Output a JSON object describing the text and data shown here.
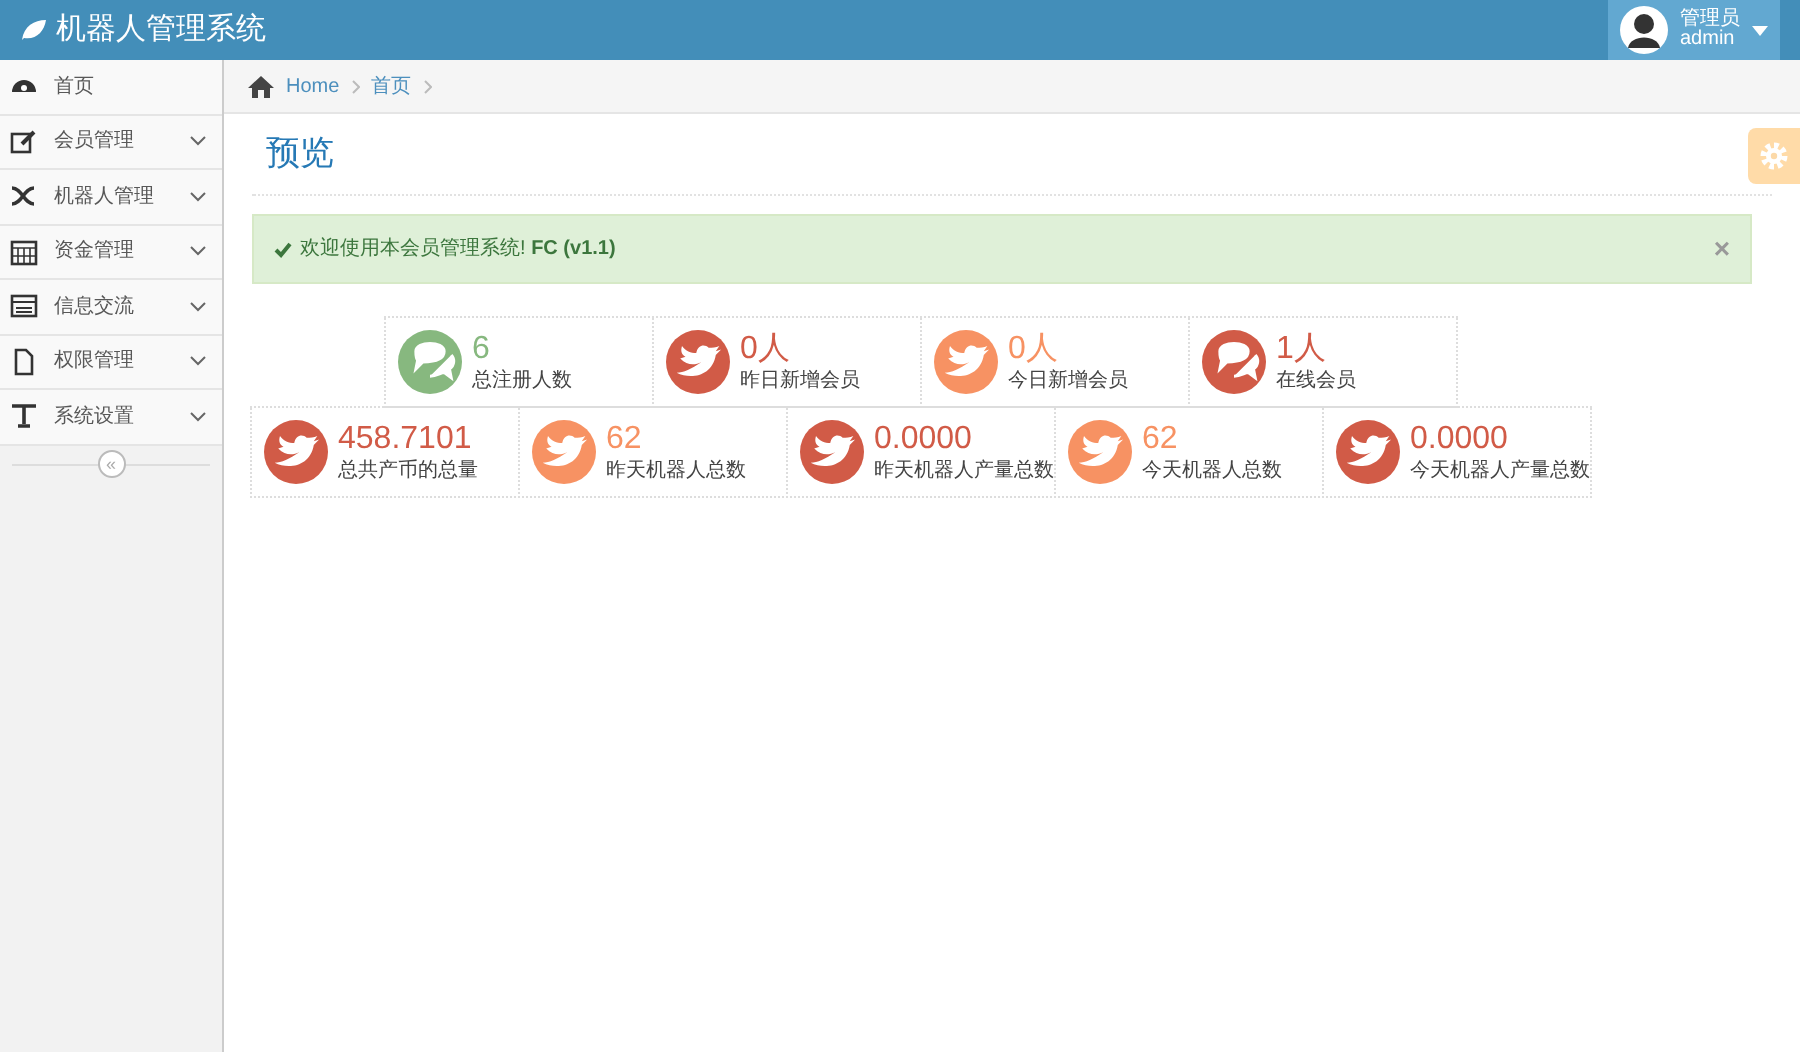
{
  "header": {
    "title": "机器人管理系统",
    "user": {
      "role": "管理员",
      "name": "admin"
    }
  },
  "sidebar": {
    "items": [
      {
        "label": "首页",
        "has_submenu": false
      },
      {
        "label": "会员管理",
        "has_submenu": true
      },
      {
        "label": "机器人管理",
        "has_submenu": true
      },
      {
        "label": "资金管理",
        "has_submenu": true
      },
      {
        "label": "信息交流",
        "has_submenu": true
      },
      {
        "label": "权限管理",
        "has_submenu": true
      },
      {
        "label": "系统设置",
        "has_submenu": true
      }
    ],
    "collapse_button": "«"
  },
  "breadcrumb": [
    "Home",
    "首页"
  ],
  "page_title": "预览",
  "alert": {
    "text": "欢迎使用本会员管理系统! **FC (v1.1)**",
    "close": "×"
  },
  "stat_rows": [
    [
      {
        "value": "6",
        "label": "总注册人数",
        "color": "#87b87f",
        "kind": "chat"
      },
      {
        "value": "0人",
        "label": "昨日新增会员",
        "color": "#d15b47",
        "kind": "bird"
      },
      {
        "value": "0人",
        "label": "今日新增会员",
        "color": "#f79263",
        "kind": "bird"
      },
      {
        "value": "1人",
        "label": "在线会员",
        "color": "#d15b47",
        "kind": "chat"
      }
    ],
    [
      {
        "value": "458.7101",
        "label": "总共产币的总量",
        "color": "#d15b47",
        "kind": "bird"
      },
      {
        "value": "62",
        "label": "昨天机器人总数",
        "color": "#f79263",
        "kind": "bird"
      },
      {
        "value": "0.0000",
        "label": "昨天机器人产量总数",
        "color": "#d15b47",
        "kind": "bird"
      },
      {
        "value": "62",
        "label": "今天机器人总数",
        "color": "#f79263",
        "kind": "bird"
      },
      {
        "value": "0.0000",
        "label": "今天机器人产量总数",
        "color": "#d15b47",
        "kind": "bird"
      }
    ]
  ]
}
